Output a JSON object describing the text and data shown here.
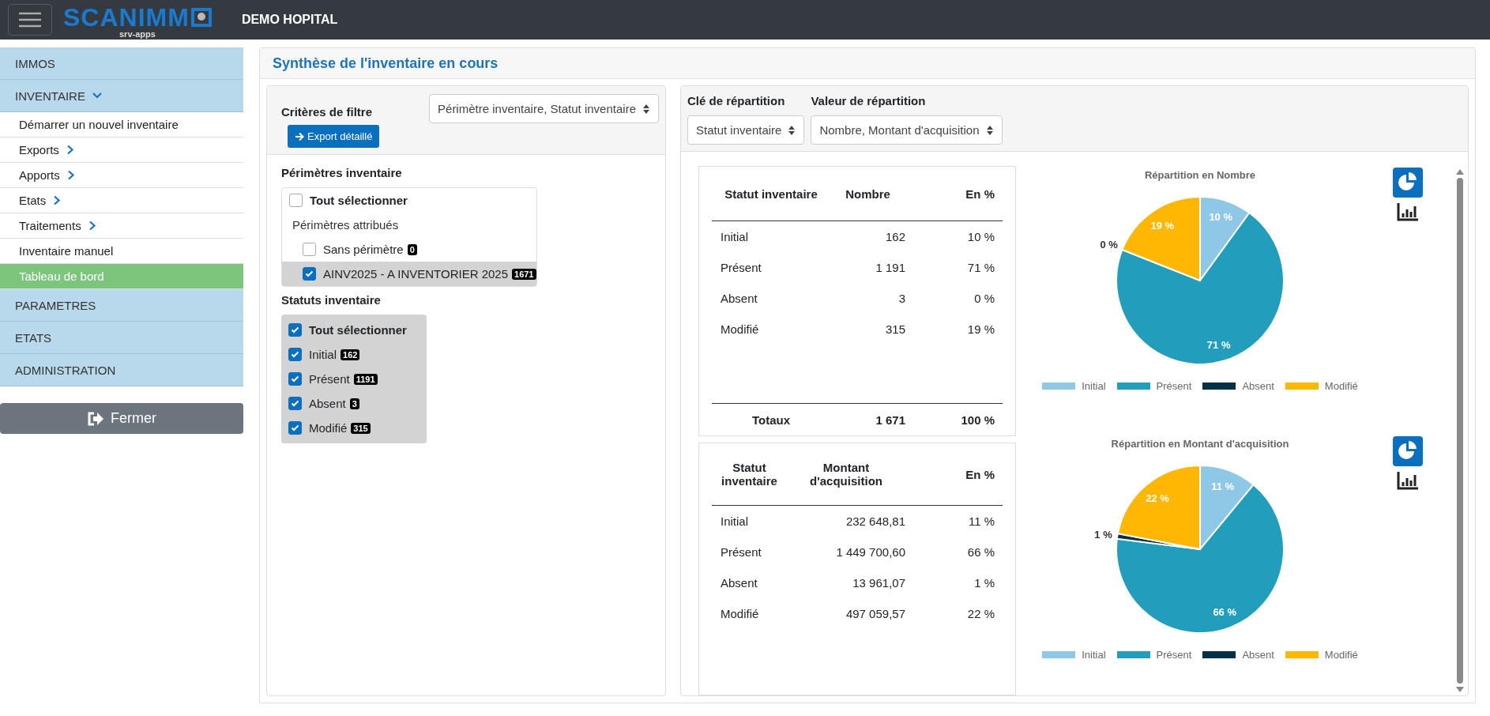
{
  "header": {
    "logo": "SCANIMM",
    "logo_subtitle": "srv-apps",
    "title": "DEMO HOPITAL"
  },
  "sidebar": {
    "items": [
      {
        "label": "IMMOS"
      },
      {
        "label": "INVENTAIRE",
        "expanded": true,
        "children": [
          {
            "label": "Démarrer un nouvel inventaire",
            "has_submenu": false,
            "selected": false
          },
          {
            "label": "Exports",
            "has_submenu": true,
            "selected": false
          },
          {
            "label": "Apports",
            "has_submenu": true,
            "selected": false
          },
          {
            "label": "Etats",
            "has_submenu": true,
            "selected": false
          },
          {
            "label": "Traitements",
            "has_submenu": true,
            "selected": false
          },
          {
            "label": "Inventaire manuel",
            "has_submenu": false,
            "selected": false
          },
          {
            "label": "Tableau de bord",
            "has_submenu": false,
            "selected": true
          }
        ]
      },
      {
        "label": "PARAMETRES"
      },
      {
        "label": "ETATS"
      },
      {
        "label": "ADMINISTRATION"
      }
    ],
    "close_button": "Fermer"
  },
  "main": {
    "title": "Synthèse de l'inventaire en cours",
    "filters": {
      "title": "Critères de filtre",
      "select_value": "Périmètre inventaire, Statut inventaire",
      "export_button": "Export détaillé",
      "perimeters": {
        "title": "Périmètres inventaire",
        "select_all": {
          "label": "Tout sélectionner",
          "checked": false
        },
        "group_label": "Périmètres attribués",
        "items": [
          {
            "label": "Sans périmètre",
            "count": "0",
            "checked": false
          },
          {
            "label": "AINV2025 - A INVENTORIER 2025",
            "count": "1671",
            "checked": true
          }
        ]
      },
      "statuses": {
        "title": "Statuts inventaire",
        "select_all": {
          "label": "Tout sélectionner",
          "checked": true
        },
        "items": [
          {
            "label": "Initial",
            "count": "162",
            "checked": true
          },
          {
            "label": "Présent",
            "count": "1191",
            "checked": true
          },
          {
            "label": "Absent",
            "count": "3",
            "checked": true
          },
          {
            "label": "Modifié",
            "count": "315",
            "checked": true
          }
        ]
      }
    },
    "distribution": {
      "key_label": "Clé de répartition",
      "key_value": "Statut inventaire",
      "value_label": "Valeur de répartition",
      "value_value": "Nombre, Montant d'acquisition",
      "tables": [
        {
          "columns": [
            "Statut inventaire",
            "Nombre",
            "En %"
          ],
          "rows": [
            [
              "Initial",
              "162",
              "10 %"
            ],
            [
              "Présent",
              "1 191",
              "71 %"
            ],
            [
              "Absent",
              "3",
              "0 %"
            ],
            [
              "Modifié",
              "315",
              "19 %"
            ]
          ],
          "totals": [
            "Totaux",
            "1 671",
            "100 %"
          ]
        },
        {
          "columns": [
            "Statut inventaire",
            "Montant d'acquisition",
            "En %"
          ],
          "rows": [
            [
              "Initial",
              "232 648,81",
              "11 %"
            ],
            [
              "Présent",
              "1 449 700,60",
              "66 %"
            ],
            [
              "Absent",
              "13 961,07",
              "1 %"
            ],
            [
              "Modifié",
              "497 059,57",
              "22 %"
            ]
          ]
        }
      ],
      "charts": [
        {
          "chart_data": {
            "type": "pie",
            "title": "Répartition en Nombre",
            "categories": [
              "Initial",
              "Présent",
              "Absent",
              "Modifié"
            ],
            "values": [
              10,
              71,
              0,
              19
            ],
            "colors": [
              "#8ec8e6",
              "#229ebc",
              "#023047",
              "#ffb703"
            ],
            "value_labels": [
              "10 %",
              "71 %",
              "0 %",
              "19 %"
            ],
            "legend": true
          }
        },
        {
          "chart_data": {
            "type": "pie",
            "title": "Répartition en Montant d'acquisition",
            "categories": [
              "Initial",
              "Présent",
              "Absent",
              "Modifié"
            ],
            "values": [
              11,
              66,
              1,
              22
            ],
            "colors": [
              "#8ec8e6",
              "#229ebc",
              "#023047",
              "#ffb703"
            ],
            "value_labels": [
              "11 %",
              "66 %",
              "1 %",
              "22 %"
            ],
            "legend": true
          }
        }
      ]
    }
  }
}
